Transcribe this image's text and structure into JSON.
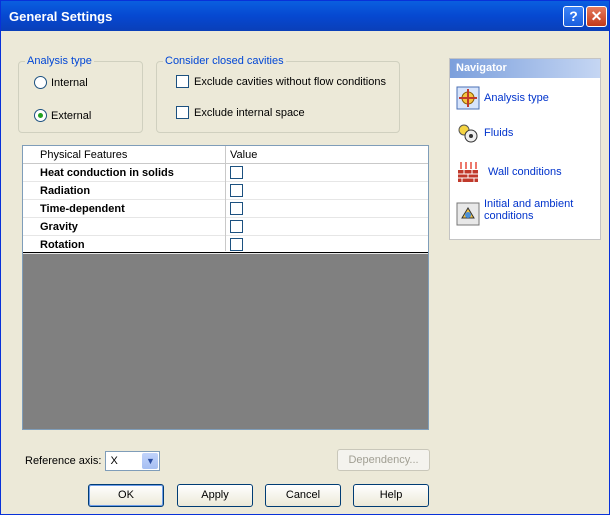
{
  "window": {
    "title": "General Settings"
  },
  "analysis_type": {
    "legend": "Analysis type",
    "options": [
      {
        "label": "Internal",
        "selected": false
      },
      {
        "label": "External",
        "selected": true
      }
    ]
  },
  "cavities": {
    "legend": "Consider closed cavities",
    "options": [
      {
        "label": "Exclude cavities without flow conditions",
        "checked": false
      },
      {
        "label": "Exclude internal space",
        "checked": false
      }
    ]
  },
  "features_table": {
    "headers": [
      "Physical Features",
      "Value"
    ],
    "rows": [
      {
        "label": "Heat conduction in solids",
        "checked": false
      },
      {
        "label": "Radiation",
        "checked": false
      },
      {
        "label": "Time-dependent",
        "checked": false
      },
      {
        "label": "Gravity",
        "checked": false
      },
      {
        "label": "Rotation",
        "checked": false
      }
    ]
  },
  "reference_axis": {
    "label": "Reference axis:",
    "value": "X"
  },
  "buttons": {
    "dependency": "Dependency...",
    "ok": "OK",
    "apply": "Apply",
    "cancel": "Cancel",
    "help": "Help"
  },
  "navigator": {
    "title": "Navigator",
    "items": [
      {
        "label": "Analysis type",
        "icon": "analysis-type-icon"
      },
      {
        "label": "Fluids",
        "icon": "fluids-icon"
      },
      {
        "label": "Wall conditions",
        "icon": "wall-conditions-icon"
      },
      {
        "label": "Initial and ambient conditions",
        "icon": "initial-conditions-icon"
      }
    ]
  },
  "colors": {
    "accent": "#0046d5",
    "title_bar": "#0648d1",
    "grid_empty": "#808080"
  }
}
